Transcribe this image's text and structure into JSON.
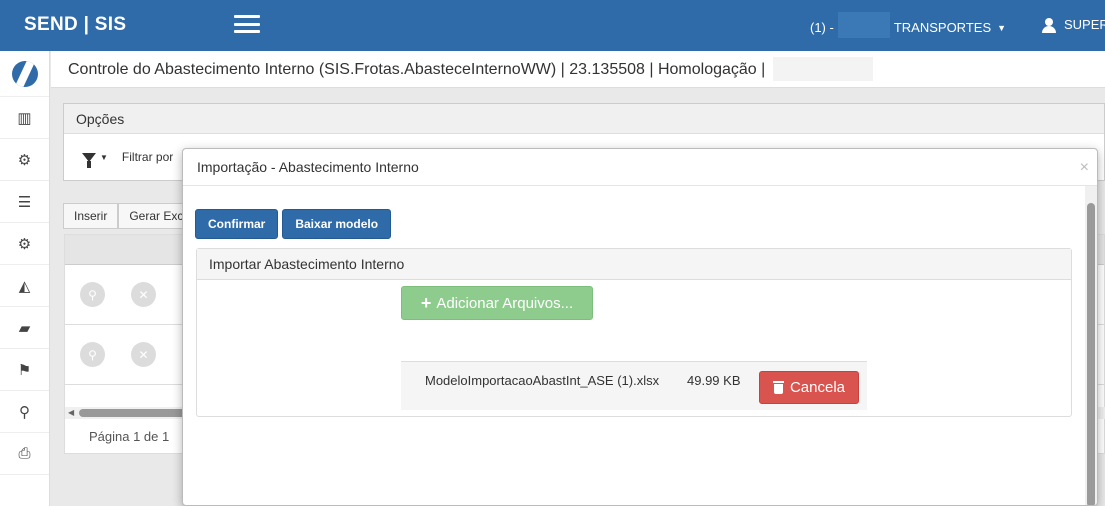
{
  "topbar": {
    "brand": "SEND | SIS",
    "company_prefix": "(1) -",
    "company_name": "TRANSPORTES",
    "company_caret": "▼",
    "user_name": "SUPER"
  },
  "header": {
    "title": "Controle do Abastecimento Interno (SIS.Frotas.AbasteceInternoWW) | 23.135508 | Homologação |"
  },
  "sidebar": {
    "items": [
      {
        "icon": "chart-bar-icon",
        "glyph": "▥"
      },
      {
        "icon": "gear-icon",
        "glyph": "⚙"
      },
      {
        "icon": "list-icon",
        "glyph": "☰"
      },
      {
        "icon": "gears-icon",
        "glyph": "⚙"
      },
      {
        "icon": "area-chart-icon",
        "glyph": "◭"
      },
      {
        "icon": "truck-icon",
        "glyph": "▰"
      },
      {
        "icon": "flag-icon",
        "glyph": "⚑"
      },
      {
        "icon": "search-icon",
        "glyph": "⚲"
      },
      {
        "icon": "print-icon",
        "glyph": "⎙"
      }
    ]
  },
  "options": {
    "title": "Opções",
    "filter_label": "Filtrar por"
  },
  "toolbar": {
    "insert_label": "Inserir",
    "export_label": "Gerar Exc"
  },
  "grid": {
    "pager": "Página 1 de 1"
  },
  "modal": {
    "title": "Importação - Abastecimento Interno",
    "close": "×",
    "confirm_label": "Confirmar",
    "download_label": "Baixar modelo",
    "panel_title": "Importar Abastecimento Interno",
    "add_files_label": "Adicionar Arquivos...",
    "file": {
      "name": "ModeloImportacaoAbastInt_ASE (1).xlsx",
      "size": "49.99 KB",
      "cancel_label": "Cancela"
    }
  },
  "colors": {
    "primary": "#2f6ba8",
    "success_disabled": "#8dcc8d",
    "danger": "#d9534f"
  }
}
